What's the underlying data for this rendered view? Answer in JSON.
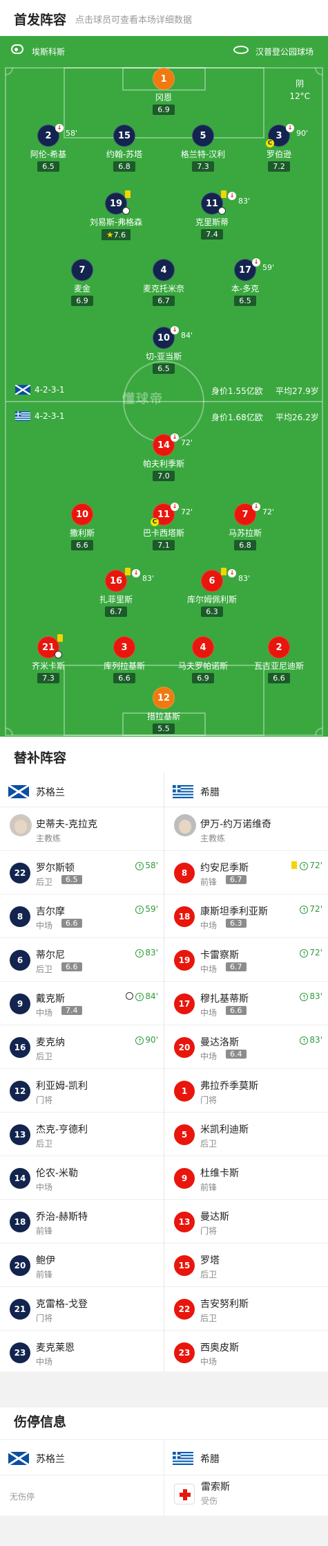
{
  "header": {
    "title": "首发阵容",
    "subtitle": "点击球员可查看本场详细数据"
  },
  "match": {
    "referee": "埃斯科斯",
    "stadium": "汉普登公园球场",
    "weather": "阴",
    "temperature": "12°C"
  },
  "home": {
    "name": "苏格兰",
    "formation": "4-2-3-1",
    "value": "身价1.55亿欧",
    "avg_age": "平均27.9岁",
    "players": [
      {
        "num": "1",
        "name": "冈恩",
        "rating": "6.9"
      },
      {
        "num": "2",
        "name": "阿伦-希基",
        "rating": "6.5",
        "sub": "58'"
      },
      {
        "num": "15",
        "name": "约翰-苏塔",
        "rating": "6.8"
      },
      {
        "num": "5",
        "name": "格兰特-汉利",
        "rating": "7.3"
      },
      {
        "num": "3",
        "name": "罗伯逊",
        "rating": "7.2",
        "sub": "90'",
        "cap": "C"
      },
      {
        "num": "19",
        "name": "刘易斯-弗格森",
        "rating": "7.6"
      },
      {
        "num": "11",
        "name": "克里斯蒂",
        "rating": "7.4",
        "sub": "83'"
      },
      {
        "num": "7",
        "name": "麦金",
        "rating": "6.9"
      },
      {
        "num": "4",
        "name": "麦克托米奈",
        "rating": "6.7"
      },
      {
        "num": "17",
        "name": "本-多克",
        "rating": "6.5",
        "sub": "59'"
      },
      {
        "num": "10",
        "name": "切-亚当斯",
        "rating": "6.5",
        "sub": "84'"
      }
    ]
  },
  "away": {
    "name": "希腊",
    "formation": "4-2-3-1",
    "value": "身价1.68亿欧",
    "avg_age": "平均26.2岁",
    "players": [
      {
        "num": "14",
        "name": "帕夫利季斯",
        "rating": "7.0",
        "sub": "72'"
      },
      {
        "num": "10",
        "name": "撒利斯",
        "rating": "6.6"
      },
      {
        "num": "11",
        "name": "巴卡西塔斯",
        "rating": "7.1",
        "sub": "72'",
        "cap": "C"
      },
      {
        "num": "7",
        "name": "马苏拉斯",
        "rating": "6.8",
        "sub": "72'"
      },
      {
        "num": "16",
        "name": "扎菲里斯",
        "rating": "6.7",
        "sub": "83'"
      },
      {
        "num": "6",
        "name": "库尔姆佩利斯",
        "rating": "6.3",
        "sub": "83'"
      },
      {
        "num": "21",
        "name": "齐米卡斯",
        "rating": "7.3"
      },
      {
        "num": "3",
        "name": "库列拉基斯",
        "rating": "6.6"
      },
      {
        "num": "4",
        "name": "马夫罗帕诺斯",
        "rating": "6.9"
      },
      {
        "num": "2",
        "name": "瓦吉亚尼迪斯",
        "rating": "6.6"
      },
      {
        "num": "12",
        "name": "措拉基斯",
        "rating": "5.5"
      }
    ]
  },
  "pitch_watermark": "懂球帝",
  "subs_section": {
    "title": "替补阵容",
    "home": {
      "coach": {
        "name": "史蒂夫-克拉克",
        "role": "主教练"
      },
      "subs": [
        {
          "num": "22",
          "name": "罗尔斯顿",
          "pos": "后卫",
          "rating": "6.5",
          "in": "58'"
        },
        {
          "num": "8",
          "name": "吉尔摩",
          "pos": "中场",
          "rating": "6.6",
          "in": "59'"
        },
        {
          "num": "6",
          "name": "蒂尔尼",
          "pos": "后卫",
          "rating": "6.6",
          "in": "83'"
        },
        {
          "num": "9",
          "name": "戴克斯",
          "pos": "中场",
          "rating": "7.4",
          "in": "84'"
        },
        {
          "num": "16",
          "name": "麦克纳",
          "pos": "后卫",
          "in": "90'"
        },
        {
          "num": "12",
          "name": "利亚姆-凯利",
          "pos": "门将"
        },
        {
          "num": "13",
          "name": "杰克-亨德利",
          "pos": "后卫"
        },
        {
          "num": "14",
          "name": "伦农-米勒",
          "pos": "中场"
        },
        {
          "num": "18",
          "name": "乔治-赫斯特",
          "pos": "前锋"
        },
        {
          "num": "20",
          "name": "鲍伊",
          "pos": "前锋"
        },
        {
          "num": "21",
          "name": "克雷格-戈登",
          "pos": "门将"
        },
        {
          "num": "23",
          "name": "麦克莱恩",
          "pos": "中场"
        }
      ]
    },
    "away": {
      "coach": {
        "name": "伊万-约万诺维奇",
        "role": "主教练"
      },
      "subs": [
        {
          "num": "8",
          "name": "约安尼季斯",
          "pos": "前锋",
          "rating": "6.7",
          "in": "72'"
        },
        {
          "num": "18",
          "name": "康斯坦季利亚斯",
          "pos": "中场",
          "rating": "6.3",
          "in": "72'"
        },
        {
          "num": "19",
          "name": "卡雷察斯",
          "pos": "中场",
          "rating": "6.7",
          "in": "72'"
        },
        {
          "num": "17",
          "name": "穆扎基蒂斯",
          "pos": "中场",
          "rating": "6.6",
          "in": "83'"
        },
        {
          "num": "20",
          "name": "曼达洛斯",
          "pos": "中场",
          "rating": "6.4",
          "in": "83'"
        },
        {
          "num": "1",
          "name": "弗拉乔季莫斯",
          "pos": "门将"
        },
        {
          "num": "5",
          "name": "米凯利迪斯",
          "pos": "后卫"
        },
        {
          "num": "9",
          "name": "杜维卡斯",
          "pos": "前锋"
        },
        {
          "num": "13",
          "name": "曼达斯",
          "pos": "门将"
        },
        {
          "num": "15",
          "name": "罗塔",
          "pos": "后卫"
        },
        {
          "num": "22",
          "name": "吉安努利斯",
          "pos": "后卫"
        },
        {
          "num": "23",
          "name": "西奥皮斯",
          "pos": "中场"
        }
      ]
    }
  },
  "injuries": {
    "title": "伤停信息",
    "home_none": "无伤停",
    "away": [
      {
        "name": "雷索斯",
        "status": "受伤"
      }
    ]
  }
}
